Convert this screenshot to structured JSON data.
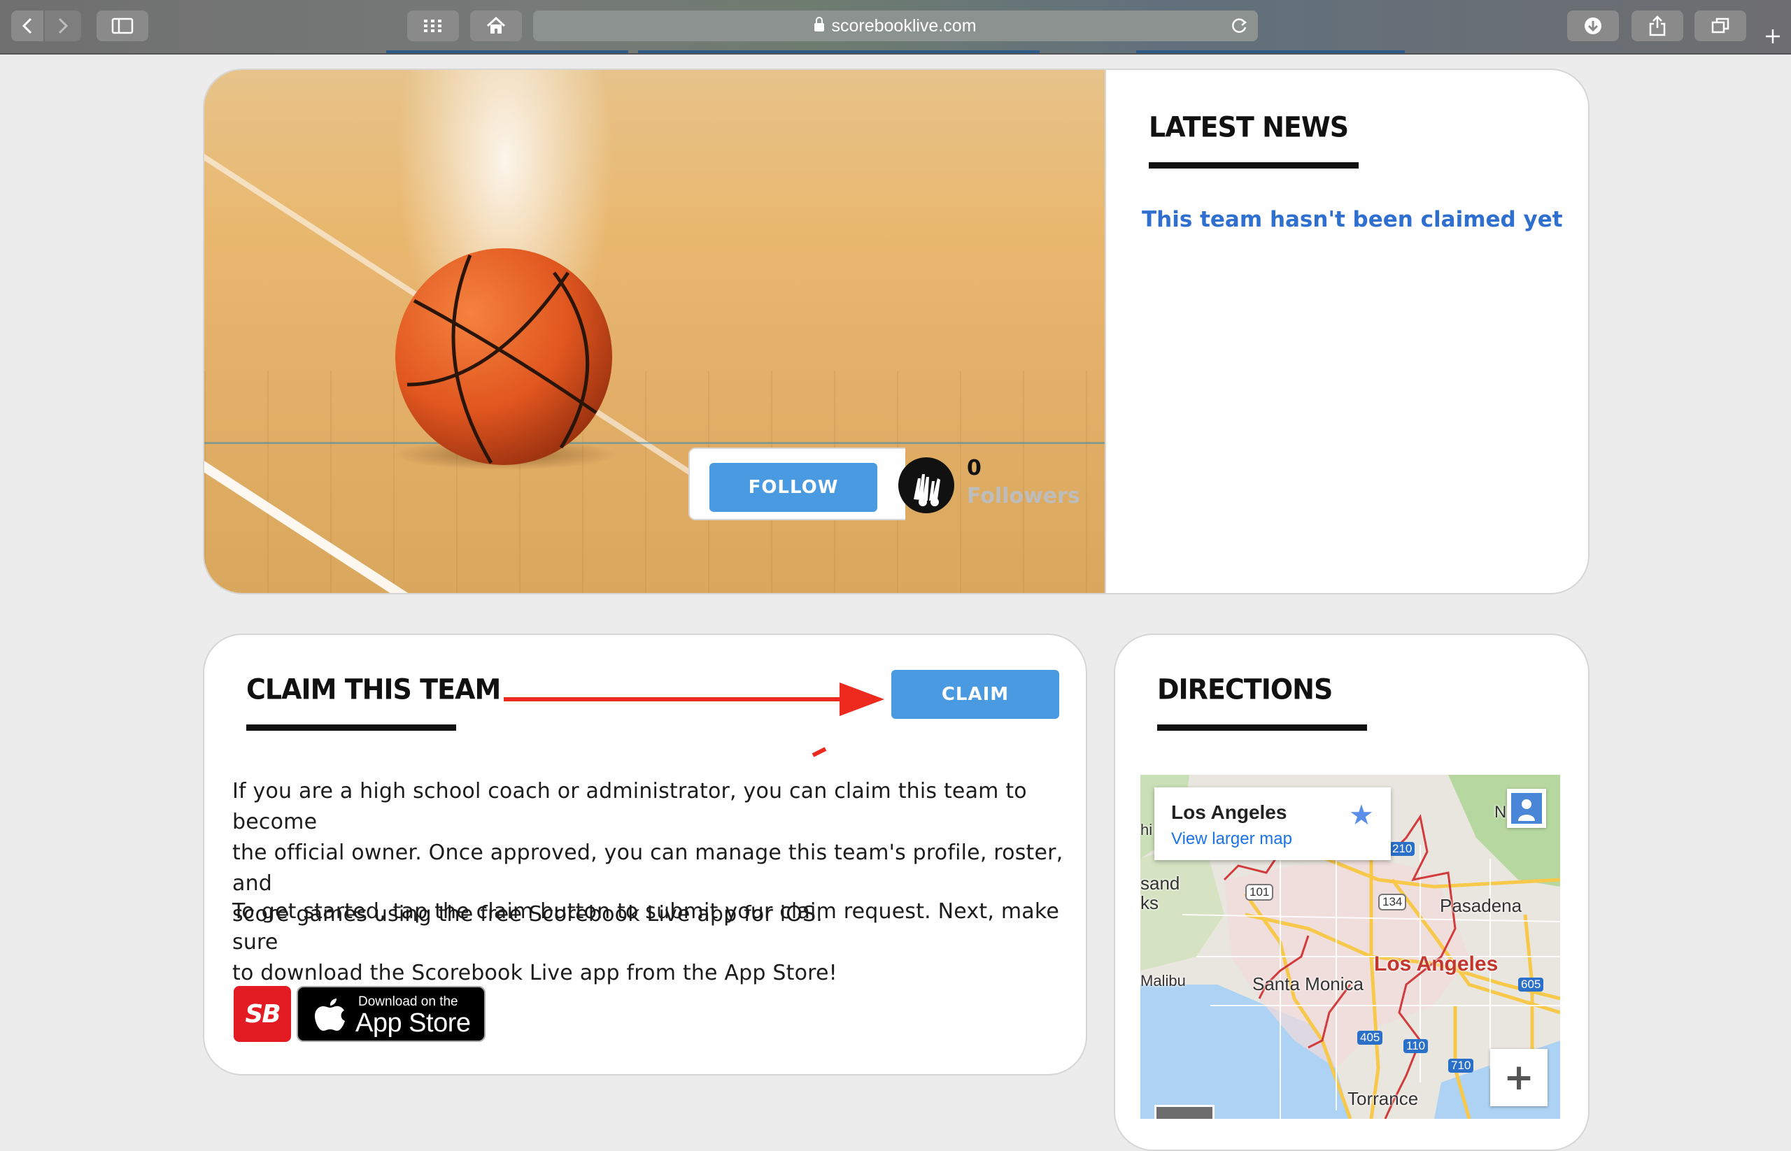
{
  "browser": {
    "url": "scorebooklive.com",
    "buttons": [
      "back",
      "forward",
      "sidebar",
      "top-sites",
      "home",
      "reload",
      "downloads",
      "share",
      "tabs",
      "new-tab"
    ]
  },
  "hero": {
    "follow_label": "FOLLOW",
    "followers_count": "0",
    "followers_label": "Followers"
  },
  "news": {
    "heading": "LATEST NEWS",
    "unclaimed_text": "This team hasn't been claimed yet"
  },
  "claim": {
    "heading": "CLAIM THIS TEAM",
    "button_label": "CLAIM",
    "paragraph1_lines": [
      "If you are a high school coach or administrator, you can claim this team to become",
      "the official owner. Once approved, you can manage this team's profile, roster, and",
      "score games using the free Scorebook Live app for iOS."
    ],
    "paragraph2_lines": [
      "To get started, tap the claim button to submit your claim request. Next, make sure",
      "to download the Scorebook Live app from the App Store!"
    ],
    "logo_text": "SB",
    "appstore_small": "Download on the",
    "appstore_big": "App Store"
  },
  "directions": {
    "heading": "DIRECTIONS",
    "map": {
      "place_title": "Los Angeles",
      "place_link": "View larger map",
      "labels": {
        "pasadena": "Pasadena",
        "los_angeles": "Los Angeles",
        "santa_monica": "Santa Monica",
        "malibu": "Malibu",
        "torrance": "Torrance",
        "sand": "sand",
        "ks": "ks",
        "n": "N",
        "hi": "hi"
      },
      "highway_shields": [
        "101",
        "134",
        "210",
        "605",
        "405",
        "110",
        "710"
      ],
      "zoom_in_label": "+"
    }
  },
  "colors": {
    "accent_blue": "#4a9ae2",
    "link_blue": "#2f6fd0",
    "annotation_red": "#ee2a1f",
    "heading_black": "#111111"
  }
}
